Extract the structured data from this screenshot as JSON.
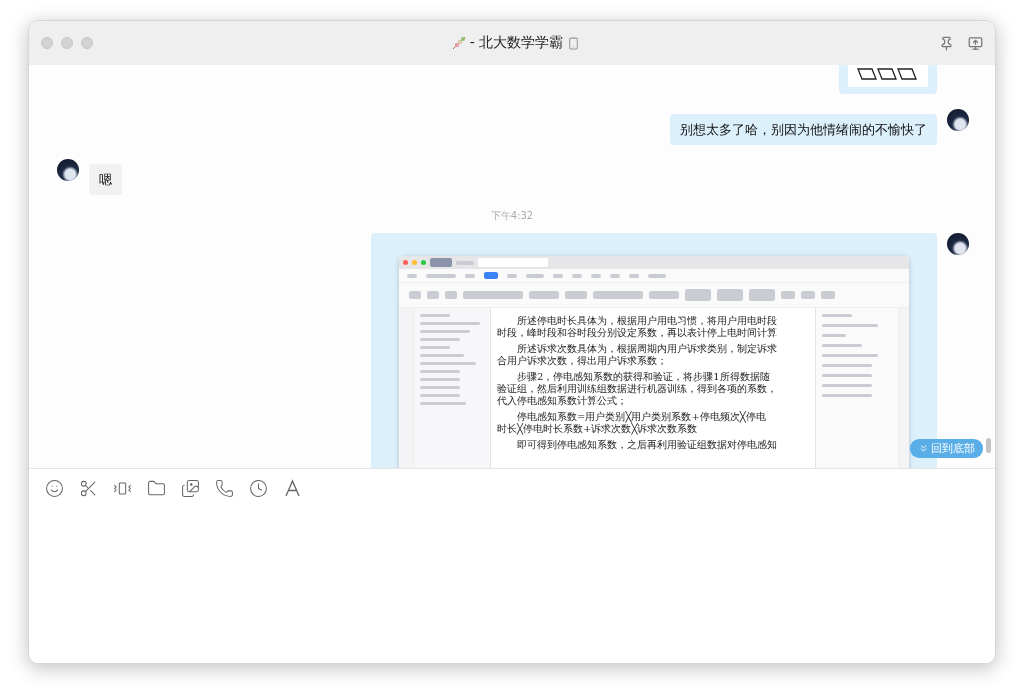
{
  "window": {
    "title": "- 北大数学学霸"
  },
  "messages": [
    {
      "kind": "sticker"
    },
    {
      "kind": "sent_text",
      "text": "别想太多了哈，别因为他情绪闹的不愉快了"
    },
    {
      "kind": "received_text",
      "text": "嗯"
    },
    {
      "kind": "time",
      "text": "下午4:32"
    },
    {
      "kind": "screenshot"
    }
  ],
  "screenshot": {
    "paragraphs": [
      [
        "所述停电时长具体为，根据用户用电习惯，将用户用电时段",
        "时段，峰时段和谷时段分别设定系数，再以表计停上电时间计算"
      ],
      [
        "所述诉求次数具体为，根据周期内用户诉求类别，制定诉求",
        "合用户诉求次数，得出用户诉求系数；"
      ],
      [
        "步骤2，停电感知系数的获得和验证，将步骤1所得数据随",
        "验证组，然后利用训练组数据进行机器训练，得到各项的系数，",
        "代入停电感知系数计算公式；"
      ],
      [
        "停电感知系数=用户类别╳用户类别系数+停电频次╳停电",
        "时长╳停电时长系数+诉求次数╳诉求次数系数"
      ],
      [
        "即可得到停电感知系数，之后再利用验证组数据对停电感知"
      ]
    ]
  },
  "back_to_bottom": "回到底部"
}
